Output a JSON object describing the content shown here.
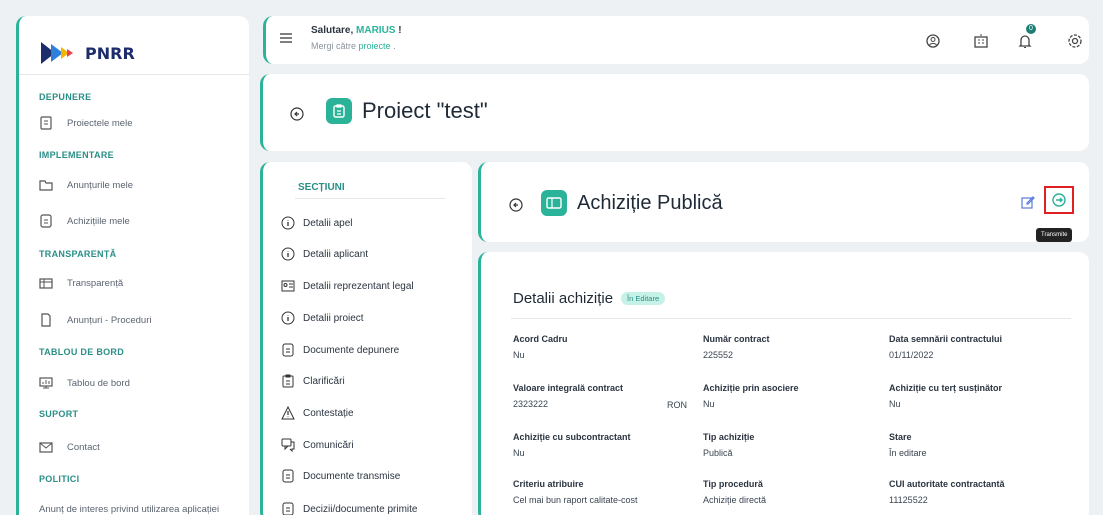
{
  "app": {
    "logo_text": "PNRR"
  },
  "header": {
    "greeting_prefix": "Salutare,",
    "user_name": "MARIUS",
    "greeting_suffix": "!",
    "sub_prefix": "Mergi către",
    "sub_link": "proiecte",
    "sub_suffix": ".",
    "notification_count": "0"
  },
  "sidebar": {
    "sections": [
      {
        "title": "DEPUNERE",
        "items": [
          {
            "label": "Proiectele mele",
            "icon": "file-icon"
          }
        ]
      },
      {
        "title": "IMPLEMENTARE",
        "items": [
          {
            "label": "Anunțurile mele",
            "icon": "folder-icon"
          },
          {
            "label": "Achizițiile mele",
            "icon": "document-icon"
          }
        ]
      },
      {
        "title": "TRANSPARENȚĂ",
        "items": [
          {
            "label": "Transparență",
            "icon": "table-icon"
          },
          {
            "label": "Anunțuri - Proceduri",
            "icon": "file-outline-icon"
          }
        ]
      },
      {
        "title": "TABLOU DE BORD",
        "items": [
          {
            "label": "Tablou de bord",
            "icon": "dashboard-icon"
          }
        ]
      },
      {
        "title": "SUPORT",
        "items": [
          {
            "label": "Contact",
            "icon": "mail-icon"
          }
        ]
      },
      {
        "title": "POLITICI",
        "items": [
          {
            "label": "Anunț de interes privind utilizarea aplicației",
            "icon": ""
          }
        ]
      }
    ]
  },
  "project": {
    "title": "Proiect \"test\""
  },
  "sections_panel": {
    "title": "SECȚIUNI",
    "items": [
      {
        "label": "Detalii apel",
        "icon": "info-icon"
      },
      {
        "label": "Detalii aplicant",
        "icon": "info-icon"
      },
      {
        "label": "Detalii reprezentant legal",
        "icon": "id-card-icon"
      },
      {
        "label": "Detalii proiect",
        "icon": "info-icon"
      },
      {
        "label": "Documente depunere",
        "icon": "document-icon"
      },
      {
        "label": "Clarificări",
        "icon": "clipboard-icon"
      },
      {
        "label": "Contestație",
        "icon": "warning-icon"
      },
      {
        "label": "Comunicări",
        "icon": "chat-icon"
      },
      {
        "label": "Documente transmise",
        "icon": "document-icon"
      },
      {
        "label": "Decizii/documente primite",
        "icon": "document-icon"
      }
    ]
  },
  "achizitie": {
    "title": "Achiziție Publică",
    "tooltip": "Transmite"
  },
  "details": {
    "title": "Detalii achiziție",
    "status": "În Editare",
    "fields": [
      {
        "label": "Acord Cadru",
        "value": "Nu"
      },
      {
        "label": "Număr contract",
        "value": "225552"
      },
      {
        "label": "Data semnării contractului",
        "value": "01/11/2022"
      },
      {
        "label": "Valoare integrală contract",
        "value": "2323222"
      },
      {
        "label": "Achiziție prin asociere",
        "value": "Nu"
      },
      {
        "label": "Achiziție cu terț susținător",
        "value": "Nu"
      },
      {
        "label": "Achiziție cu subcontractant",
        "value": "Nu"
      },
      {
        "label": "Tip achiziție",
        "value": "Publică"
      },
      {
        "label": "Stare",
        "value": "În editare"
      },
      {
        "label": "Criteriu atribuire",
        "value": "Cel mai bun raport calitate-cost"
      },
      {
        "label": "Tip procedură",
        "value": "Achiziție directă"
      },
      {
        "label": "CUI autoritate contractantă",
        "value": "11125522"
      }
    ],
    "currency": "RON"
  },
  "colors": {
    "accent": "#2bb39a",
    "brand_dark": "#1d2d6b",
    "highlight": "#e02020"
  }
}
